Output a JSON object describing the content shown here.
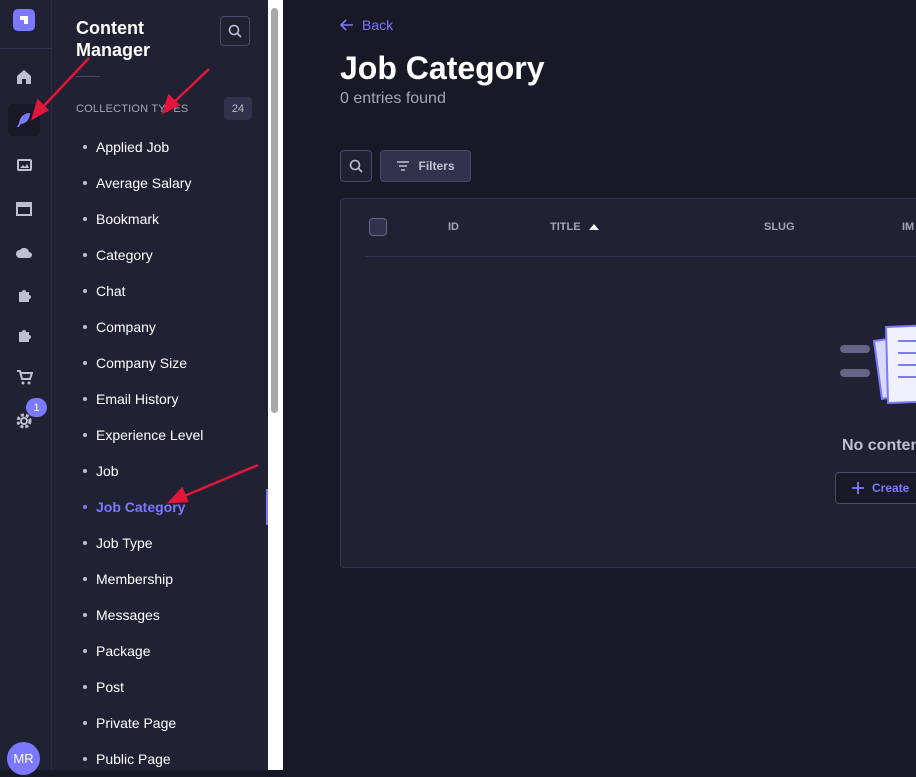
{
  "rail": {
    "items": [
      {
        "icon": "home-icon",
        "active": false
      },
      {
        "icon": "content-manager-icon",
        "active": true
      },
      {
        "icon": "media-library-icon",
        "active": false
      },
      {
        "icon": "layout-icon",
        "active": false
      },
      {
        "icon": "cloud-icon",
        "active": false
      },
      {
        "icon": "plugin-icon",
        "active": false
      },
      {
        "icon": "plugin-icon",
        "active": false
      },
      {
        "icon": "cart-icon",
        "active": false
      },
      {
        "icon": "gear-icon",
        "active": false
      }
    ],
    "settings_badge": "1",
    "avatar_initials": "MR"
  },
  "subnav": {
    "title": "Content Manager",
    "section_label": "COLLECTION TYPES",
    "section_count": "24",
    "items": [
      {
        "label": "Applied Job",
        "active": false
      },
      {
        "label": "Average Salary",
        "active": false
      },
      {
        "label": "Bookmark",
        "active": false
      },
      {
        "label": "Category",
        "active": false
      },
      {
        "label": "Chat",
        "active": false
      },
      {
        "label": "Company",
        "active": false
      },
      {
        "label": "Company Size",
        "active": false
      },
      {
        "label": "Email History",
        "active": false
      },
      {
        "label": "Experience Level",
        "active": false
      },
      {
        "label": "Job",
        "active": false
      },
      {
        "label": "Job Category",
        "active": true
      },
      {
        "label": "Job Type",
        "active": false
      },
      {
        "label": "Membership",
        "active": false
      },
      {
        "label": "Messages",
        "active": false
      },
      {
        "label": "Package",
        "active": false
      },
      {
        "label": "Post",
        "active": false
      },
      {
        "label": "Private Page",
        "active": false
      },
      {
        "label": "Public Page",
        "active": false
      }
    ]
  },
  "main": {
    "back_label": "Back",
    "title": "Job Category",
    "entries_text": "0 entries found",
    "filters_label": "Filters",
    "columns": [
      "ID",
      "TITLE",
      "SLUG",
      "IM"
    ],
    "empty_text": "No conten",
    "create_label": "Create"
  },
  "colors": {
    "accent": "#7b79ff",
    "annotation_arrow": "#e0173a",
    "background": "#181826",
    "panel": "#212134"
  }
}
